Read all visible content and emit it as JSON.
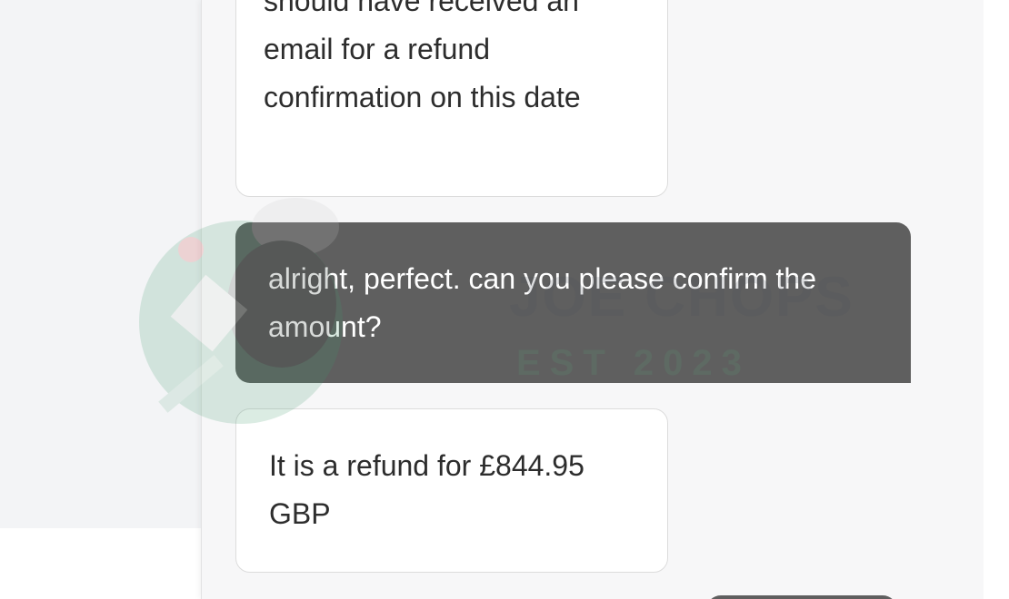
{
  "messages": [
    {
      "role": "agent",
      "text": "should have received an email for a refund confirmation on this date"
    },
    {
      "role": "user",
      "text": "alright, perfect. can you please confirm the amount?"
    },
    {
      "role": "agent",
      "text": "It is a refund for £844.95 GBP"
    }
  ],
  "watermark": {
    "line1": "JOE CHOPS",
    "line2": "EST 2023"
  },
  "colors": {
    "user_bubble": "#5f5f5f",
    "agent_bubble": "#ffffff",
    "panel_bg": "#f7f7f8"
  }
}
